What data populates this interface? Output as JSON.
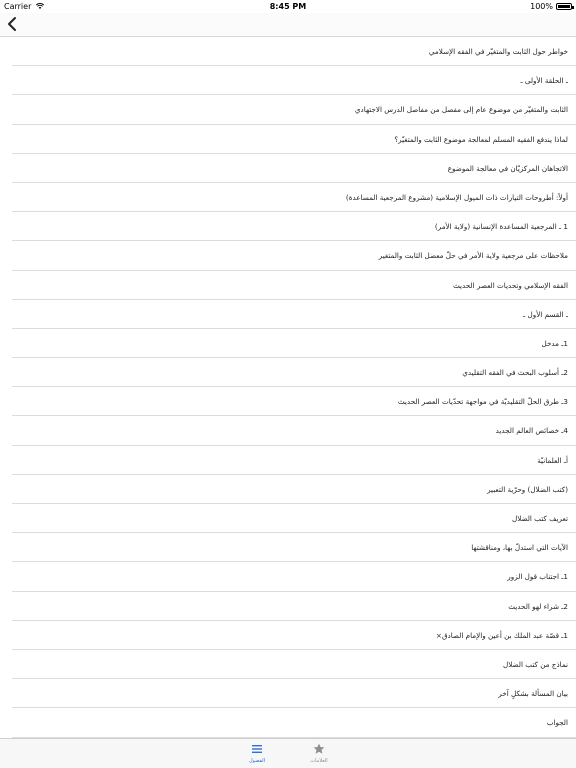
{
  "status": {
    "carrier": "Carrier",
    "time": "8:45 PM",
    "battery": "100%"
  },
  "nav": {
    "back_icon": "chevron-left-icon"
  },
  "items": [
    "خواطر حول الثابت والمتغيّر في الفقه الإسلامي",
    "ـ الحلقة الأولى ـ",
    "الثابت والمتغيّر من موضوع عام إلى مفصل من مفاصل الدرس الاجتهادي",
    "لماذا يندفع الفقيه المسلم لمعالجة موضوع الثابت والمتغيّر؟",
    "الاتجاهان المركزيّان في معالجة الموضوع",
    "أولاً: أطروحات التيارات ذات الميول الإسلامية (مشروع المرجعية المساعدة)",
    "1 ـ المرجعية المساعدة الإنسانية (ولاية الأمر)",
    "ملاحظات على مرجعية ولاية الأمر في حلّ معضل الثابت والمتغير",
    "الفقه الإسلامي وتحديات العصر الحديث",
    "ـ القسم الأول ـ",
    "1ـ مدخل",
    "2ـ أسلوب البحث في الفقه التقليدي",
    "3ـ طرق الحلّ التقليديّة في مواجهة تحدّيات العصر الحديث",
    "4ـ خصائص العالم الجديد",
    "أـ العلمانيّة",
    "(كتب الضلال) وحرّية التعبير",
    "تعريف كتب الضلال",
    "الآيات التي استدلّ بها، ومناقشتها",
    "1ـ اجتناب قول الزور",
    "2ـ شراء لهو الحديث",
    "1ـ قصّة عبد الملك بن أعين والإمام الصادق×",
    "نماذج من كتب الضلال",
    "بيان المسألة بشكلٍ آخر",
    "الجواب"
  ],
  "tabs": {
    "chapters": {
      "label": "الفصول",
      "icon": "list-icon",
      "color": "#2f6fd6"
    },
    "bookmarks": {
      "label": "العلامات",
      "icon": "star-icon",
      "color": "#8e8e8e"
    }
  }
}
